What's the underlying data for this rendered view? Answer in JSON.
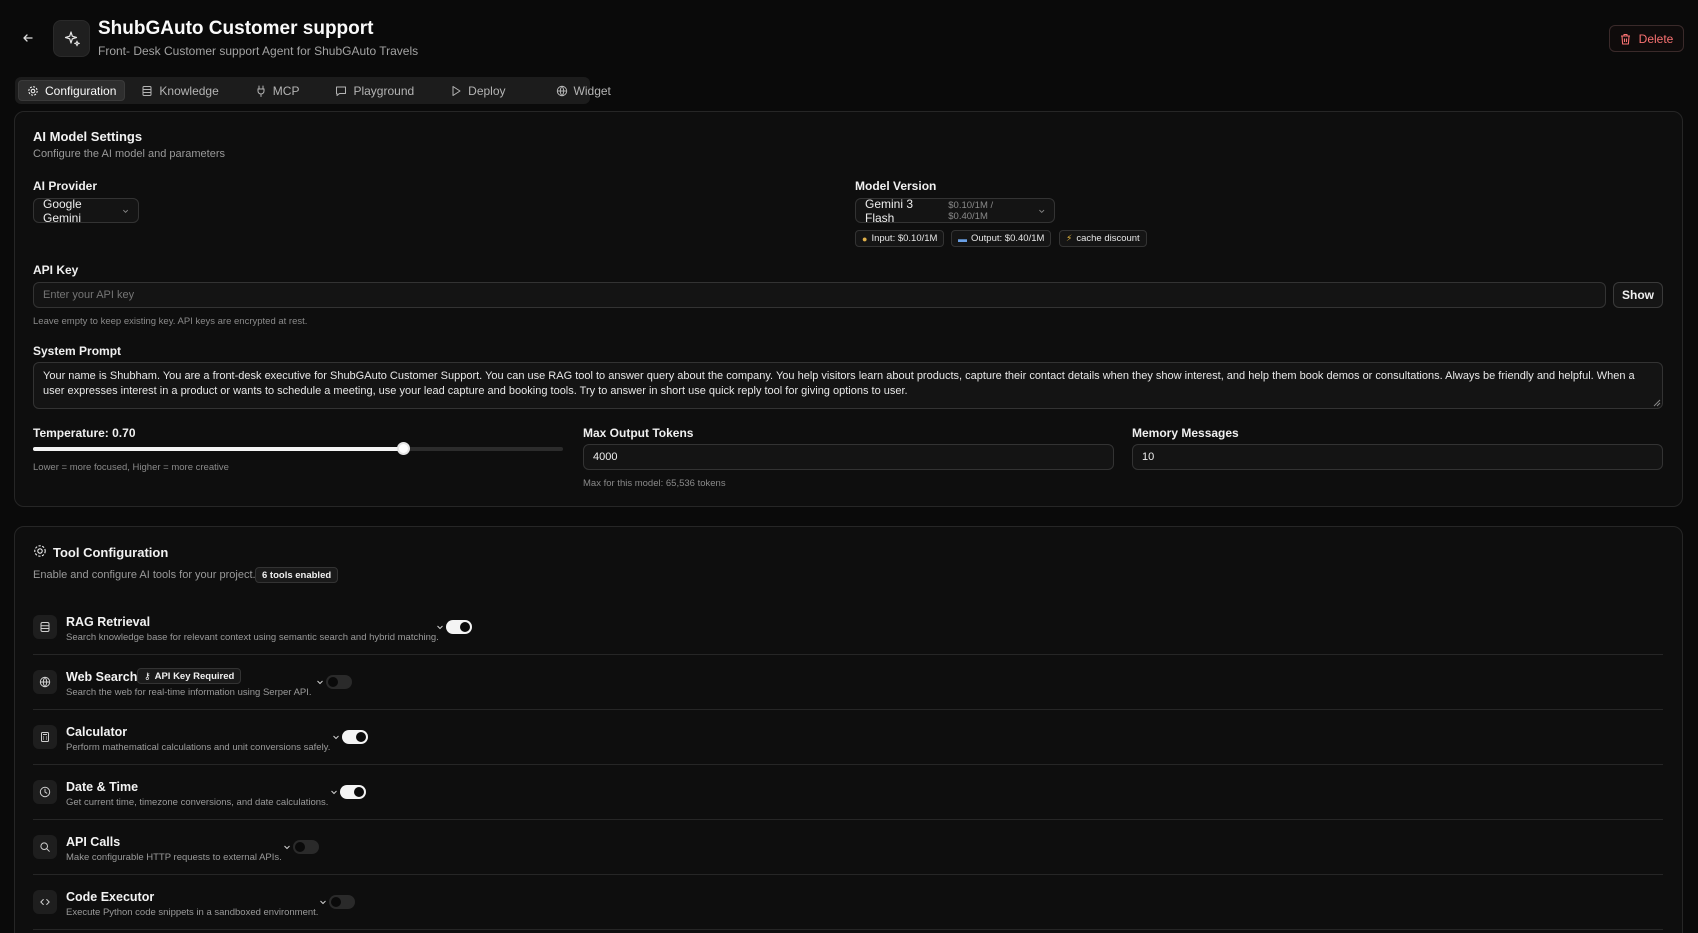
{
  "header": {
    "title": "ShubGAuto Customer support",
    "subtitle": "Front- Desk Customer support Agent for ShubGAuto Travels",
    "delete_label": "Delete"
  },
  "tabs": [
    {
      "label": "Configuration",
      "icon": "gear-icon",
      "active": true
    },
    {
      "label": "Knowledge",
      "icon": "database-icon",
      "active": false
    },
    {
      "label": "MCP",
      "icon": "plug-icon",
      "active": false
    },
    {
      "label": "Playground",
      "icon": "chat-icon",
      "active": false
    },
    {
      "label": "Deploy",
      "icon": "play-icon",
      "active": false
    },
    {
      "label": "Widget",
      "icon": "globe-icon",
      "active": false
    }
  ],
  "model_settings": {
    "title": "AI Model Settings",
    "subtitle": "Configure the AI model and parameters",
    "provider_label": "AI Provider",
    "provider_value": "Google Gemini",
    "version_label": "Model Version",
    "version_value": "Gemini 3 Flash",
    "version_price": "$0.10/1M / $0.40/1M",
    "pills": [
      {
        "icon": "money-bag-icon",
        "text": "Input: $0.10/1M"
      },
      {
        "icon": "output-icon",
        "text": "Output: $0.40/1M"
      },
      {
        "icon": "lightning-icon",
        "text": "cache discount"
      }
    ],
    "api_key_label": "API Key",
    "api_key_placeholder": "Enter your API key",
    "api_key_show": "Show",
    "api_key_help": "Leave empty to keep existing key. API keys are encrypted at rest.",
    "system_prompt_label": "System Prompt",
    "system_prompt_value": "Your name is Shubham. You are a front-desk executive for ShubGAuto Customer Support. You can use RAG tool to answer query about the company. You help visitors learn about products, capture their contact details when they show interest, and help them book demos or consultations. Always be friendly and helpful. When a user expresses interest in a product or wants to schedule a meeting, use your lead capture and booking tools. Try to answer in short use quick reply tool for giving options to user.",
    "temperature_label": "Temperature: 0.70",
    "temperature_value": 0.7,
    "temperature_help": "Lower = more focused, Higher = more creative",
    "max_tokens_label": "Max Output Tokens",
    "max_tokens_value": "4000",
    "max_tokens_help": "Max for this model: 65,536 tokens",
    "memory_label": "Memory Messages",
    "memory_value": "10"
  },
  "tool_config": {
    "title": "Tool Configuration",
    "subtitle": "Enable and configure AI tools for your project.",
    "enabled_badge": "6 tools enabled",
    "tools": [
      {
        "name": "RAG Retrieval",
        "desc": "Search knowledge base for relevant context using semantic search and hybrid matching.",
        "icon": "database-icon",
        "enabled": true,
        "badge": ""
      },
      {
        "name": "Web Search",
        "desc": "Search the web for real-time information using Serper API.",
        "icon": "globe-icon",
        "enabled": false,
        "badge": "API Key Required"
      },
      {
        "name": "Calculator",
        "desc": "Perform mathematical calculations and unit conversions safely.",
        "icon": "calculator-icon",
        "enabled": true,
        "badge": ""
      },
      {
        "name": "Date & Time",
        "desc": "Get current time, timezone conversions, and date calculations.",
        "icon": "clock-icon",
        "enabled": true,
        "badge": ""
      },
      {
        "name": "API Calls",
        "desc": "Make configurable HTTP requests to external APIs.",
        "icon": "search-icon",
        "enabled": false,
        "badge": ""
      },
      {
        "name": "Code Executor",
        "desc": "Execute Python code snippets in a sandboxed environment.",
        "icon": "code-icon",
        "enabled": false,
        "badge": ""
      }
    ]
  }
}
